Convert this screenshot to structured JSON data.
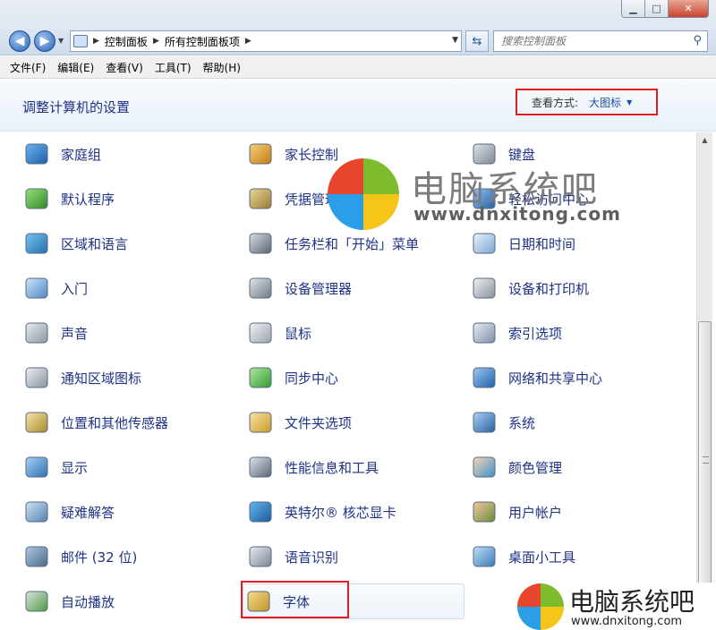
{
  "window": {
    "minimize": "▁",
    "maximize": "□",
    "close": "✕"
  },
  "address": {
    "crumbs": [
      "控制面板",
      "所有控制面板项"
    ],
    "search_placeholder": "搜索控制面板"
  },
  "menu": [
    "文件(F)",
    "编辑(E)",
    "查看(V)",
    "工具(T)",
    "帮助(H)"
  ],
  "header": {
    "title": "调整计算机的设置",
    "view_label": "查看方式:",
    "view_value": "大图标"
  },
  "items": [
    {
      "label": "家庭组",
      "icon": "homegroup-icon"
    },
    {
      "label": "家长控制",
      "icon": "parental-controls-icon"
    },
    {
      "label": "键盘",
      "icon": "keyboard-icon"
    },
    {
      "label": "默认程序",
      "icon": "default-programs-icon"
    },
    {
      "label": "凭据管理器",
      "icon": "credential-manager-icon"
    },
    {
      "label": "轻松访问中心",
      "icon": "ease-of-access-icon"
    },
    {
      "label": "区域和语言",
      "icon": "region-language-icon"
    },
    {
      "label": "任务栏和「开始」菜单",
      "icon": "taskbar-icon"
    },
    {
      "label": "日期和时间",
      "icon": "calendar-clock-icon"
    },
    {
      "label": "入门",
      "icon": "getting-started-icon"
    },
    {
      "label": "设备管理器",
      "icon": "device-manager-icon"
    },
    {
      "label": "设备和打印机",
      "icon": "printer-icon"
    },
    {
      "label": "声音",
      "icon": "speaker-icon"
    },
    {
      "label": "鼠标",
      "icon": "mouse-icon"
    },
    {
      "label": "索引选项",
      "icon": "indexing-icon"
    },
    {
      "label": "通知区域图标",
      "icon": "notification-area-icon"
    },
    {
      "label": "同步中心",
      "icon": "sync-center-icon"
    },
    {
      "label": "网络和共享中心",
      "icon": "network-icon"
    },
    {
      "label": "位置和其他传感器",
      "icon": "location-sensor-icon"
    },
    {
      "label": "文件夹选项",
      "icon": "folder-options-icon"
    },
    {
      "label": "系统",
      "icon": "system-icon"
    },
    {
      "label": "显示",
      "icon": "display-icon"
    },
    {
      "label": "性能信息和工具",
      "icon": "performance-icon"
    },
    {
      "label": "颜色管理",
      "icon": "color-management-icon"
    },
    {
      "label": "疑难解答",
      "icon": "troubleshooting-icon"
    },
    {
      "label": "英特尔® 核芯显卡",
      "icon": "intel-graphics-icon"
    },
    {
      "label": "用户帐户",
      "icon": "user-accounts-icon"
    },
    {
      "label": "邮件 (32 位)",
      "icon": "mail-icon"
    },
    {
      "label": "语音识别",
      "icon": "microphone-icon"
    },
    {
      "label": "桌面小工具",
      "icon": "gadgets-icon"
    },
    {
      "label": "自动播放",
      "icon": "autoplay-icon"
    },
    {
      "label": "字体",
      "icon": "fonts-icon"
    }
  ],
  "watermark": {
    "title": "电脑系统吧",
    "url": "www.dnxitong.com"
  },
  "colors": {
    "link": "#1e3287",
    "accent_red": "#e11b22"
  }
}
